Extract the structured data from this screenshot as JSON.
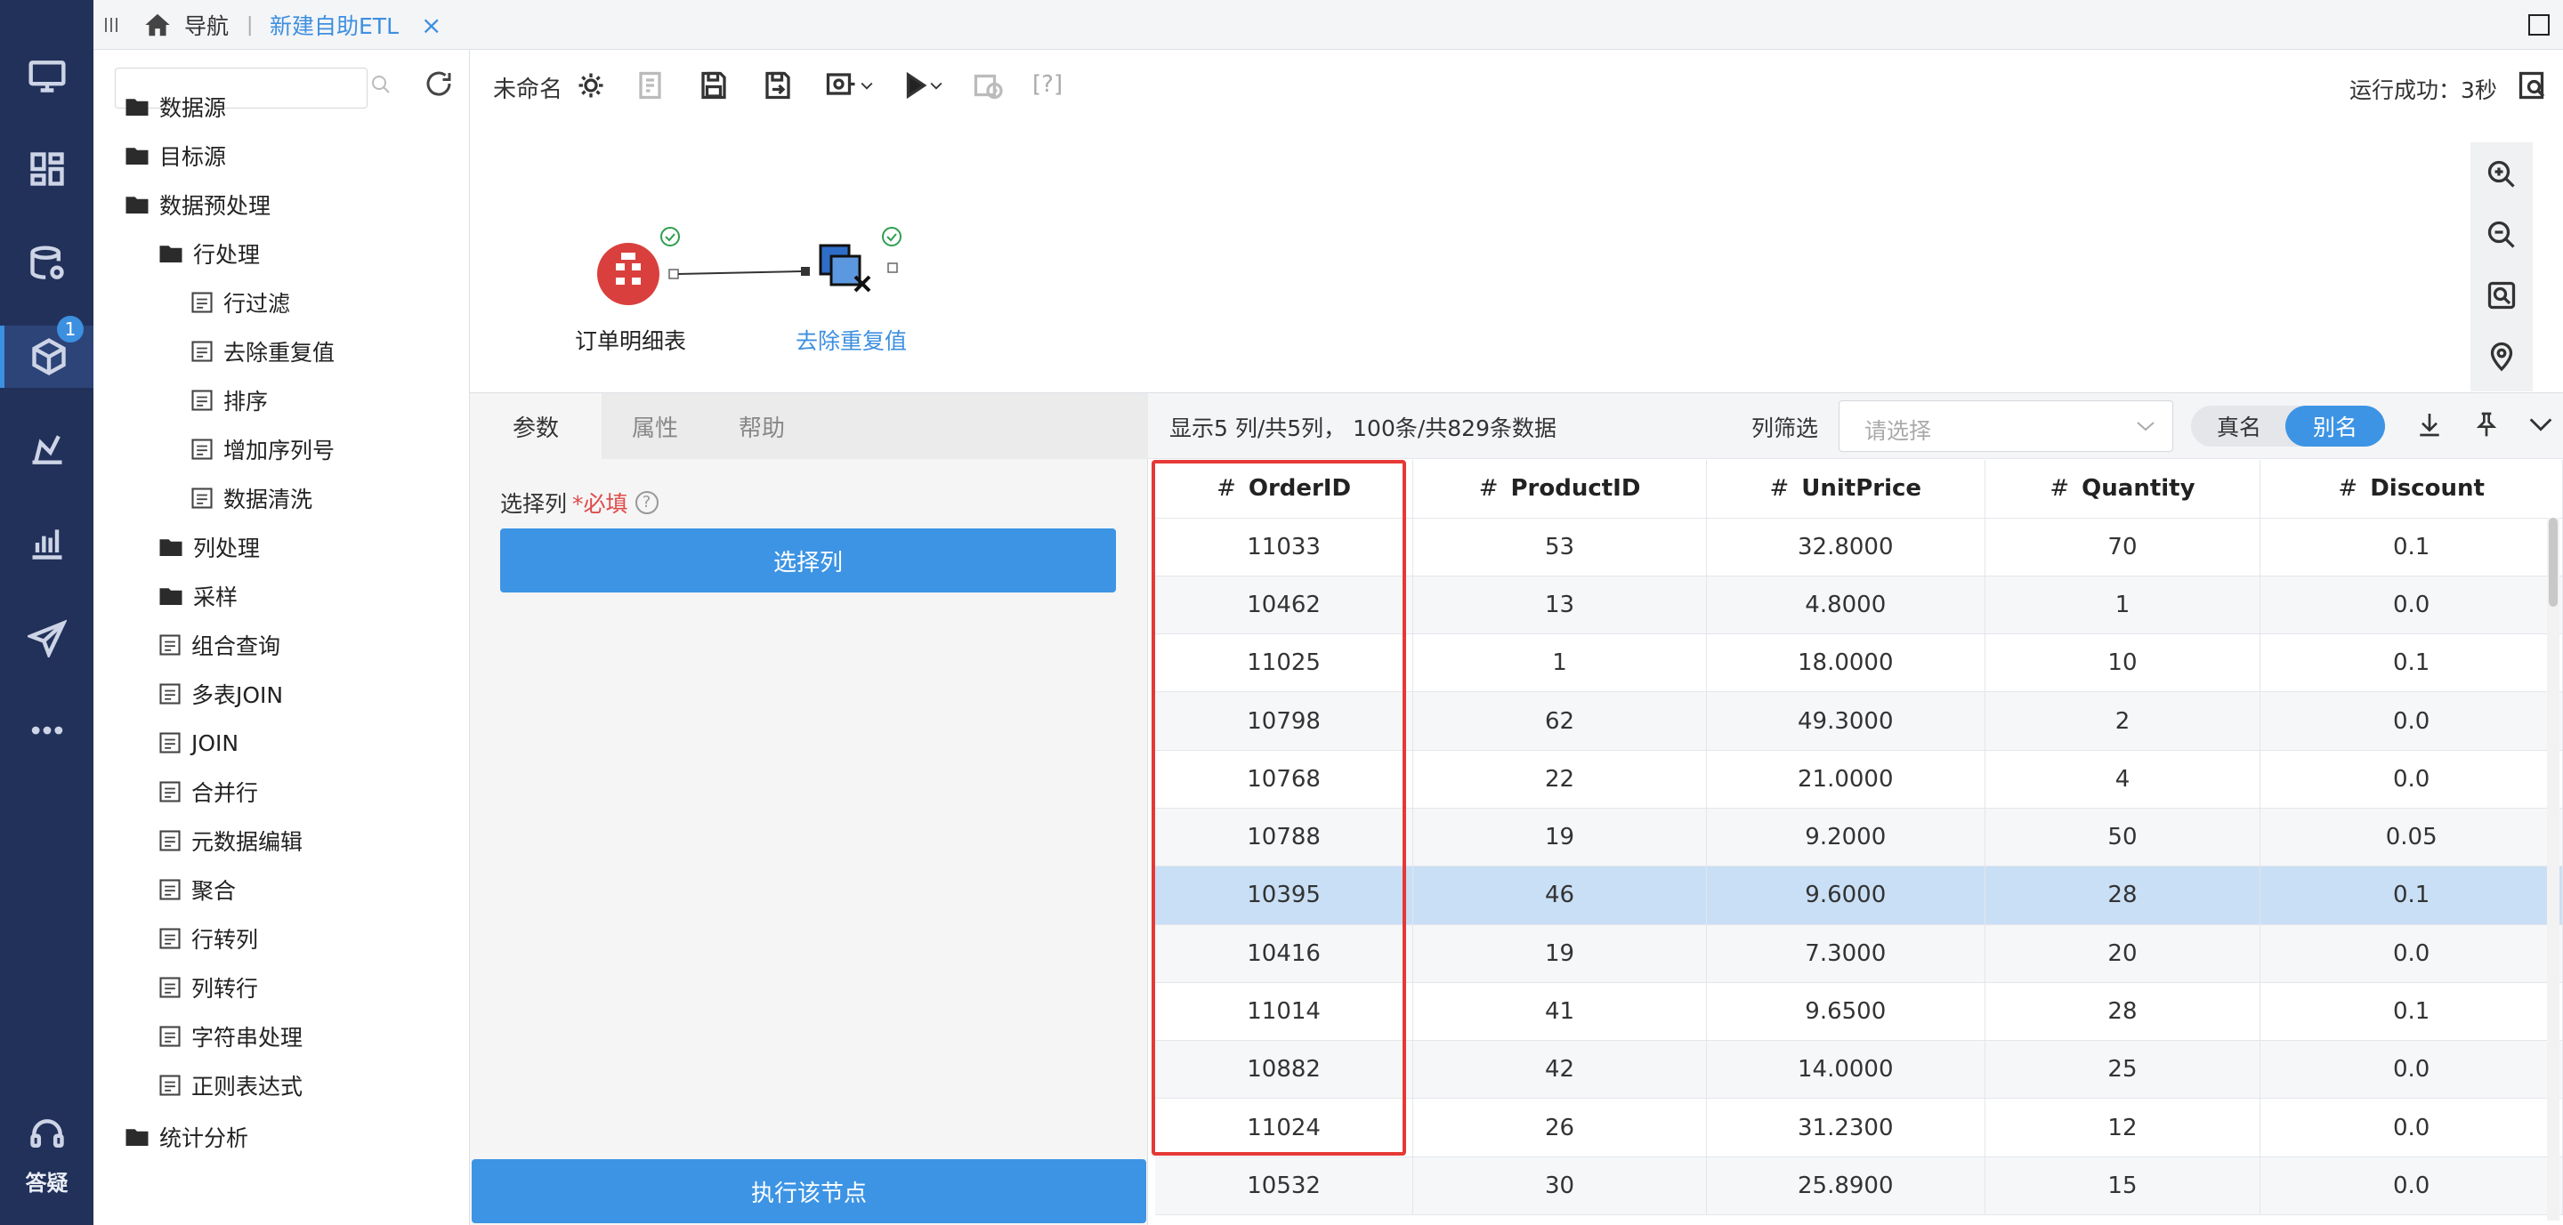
{
  "leftnav": {
    "items": [
      "desktop-icon",
      "dashboard-icon",
      "database-settings-icon",
      "etl-cube-icon",
      "model-icon",
      "chart-icon",
      "send-icon",
      "more-icon"
    ],
    "active_badge": "1",
    "help_label": "答疑"
  },
  "topbar": {
    "nav_label": "导航",
    "separator": "|",
    "tab_label": "新建自助ETL",
    "close_glyph": "×"
  },
  "sidebar": {
    "search_placeholder": "",
    "tree": [
      {
        "label": "数据源",
        "level": 0
      },
      {
        "label": "目标源",
        "level": 0
      },
      {
        "label": "数据预处理",
        "level": 0
      },
      {
        "label": "行处理",
        "level": 1
      },
      {
        "label": "行过滤",
        "level": 2
      },
      {
        "label": "去除重复值",
        "level": 2
      },
      {
        "label": "排序",
        "level": 2
      },
      {
        "label": "增加序列号",
        "level": 2
      },
      {
        "label": "数据清洗",
        "level": 2
      },
      {
        "label": "列处理",
        "level": 1
      },
      {
        "label": "采样",
        "level": 1
      },
      {
        "label": "组合查询",
        "level": 1
      },
      {
        "label": "多表JOIN",
        "level": 1
      },
      {
        "label": "JOIN",
        "level": 1
      },
      {
        "label": "合并行",
        "level": 1
      },
      {
        "label": "元数据编辑",
        "level": 1
      },
      {
        "label": "聚合",
        "level": 1
      },
      {
        "label": "行转列",
        "level": 1
      },
      {
        "label": "列转行",
        "level": 1
      },
      {
        "label": "字符串处理",
        "level": 1
      },
      {
        "label": "正则表达式",
        "level": 1
      },
      {
        "label": "统计分析",
        "level": 0
      }
    ]
  },
  "toolbar": {
    "title": "未命名",
    "help_bracket": "[?]",
    "run_status": "运行成功：3秒"
  },
  "canvas": {
    "node1_label": "订单明细表",
    "node2_label": "去除重复值"
  },
  "param_panel": {
    "tabs": [
      "参数",
      "属性",
      "帮助"
    ],
    "select_label": "选择列",
    "required_mark": "*必填",
    "select_button": "选择列",
    "execute_button": "执行该节点"
  },
  "data_panel": {
    "summary": "显示5 列/共5列， 100条/共829条数据",
    "filter_label": "列筛选",
    "filter_placeholder": "请选择",
    "toggle_real": "真名",
    "toggle_alias": "别名",
    "columns": [
      "OrderID",
      "ProductID",
      "UnitPrice",
      "Quantity",
      "Discount"
    ],
    "rows": [
      [
        "11033",
        "53",
        "32.8000",
        "70",
        "0.1"
      ],
      [
        "10462",
        "13",
        "4.8000",
        "1",
        "0.0"
      ],
      [
        "11025",
        "1",
        "18.0000",
        "10",
        "0.1"
      ],
      [
        "10798",
        "62",
        "49.3000",
        "2",
        "0.0"
      ],
      [
        "10768",
        "22",
        "21.0000",
        "4",
        "0.0"
      ],
      [
        "10788",
        "19",
        "9.2000",
        "50",
        "0.05"
      ],
      [
        "10395",
        "46",
        "9.6000",
        "28",
        "0.1"
      ],
      [
        "10416",
        "19",
        "7.3000",
        "20",
        "0.0"
      ],
      [
        "11014",
        "41",
        "9.6500",
        "28",
        "0.1"
      ],
      [
        "10882",
        "42",
        "14.0000",
        "25",
        "0.0"
      ],
      [
        "11024",
        "26",
        "31.2300",
        "12",
        "0.0"
      ],
      [
        "10532",
        "30",
        "25.8900",
        "15",
        "0.0"
      ]
    ],
    "selected_row_index": 6,
    "highlight_color": "#e53935"
  }
}
